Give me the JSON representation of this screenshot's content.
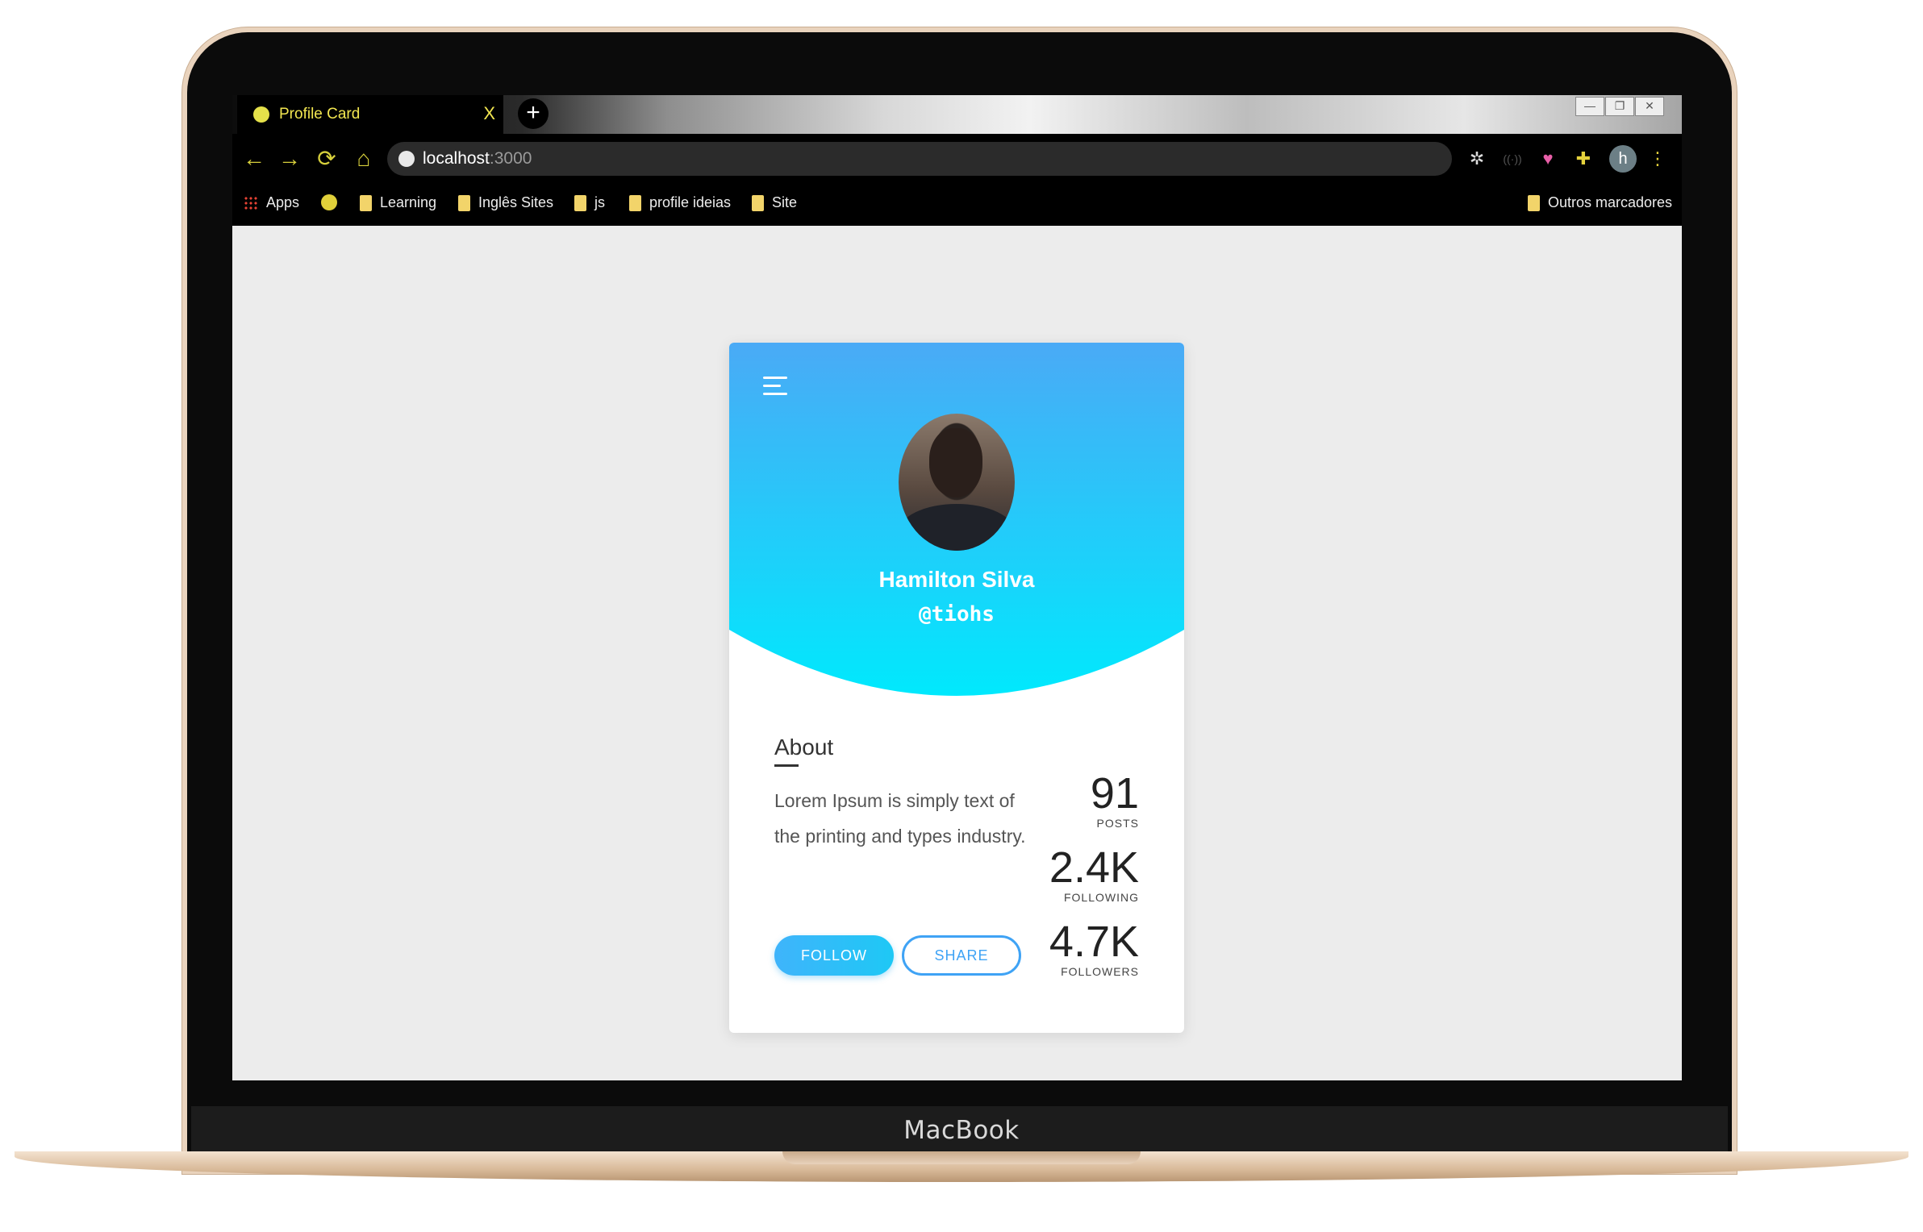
{
  "device": {
    "brand": "MacBook"
  },
  "browser": {
    "tab": {
      "title": "Profile Card",
      "close_label": "X",
      "new_tab_label": "+"
    },
    "window_controls": [
      "—",
      "❐",
      "✕"
    ],
    "nav": {
      "back": "←",
      "forward": "→",
      "reload": "⟳",
      "home": "⌂"
    },
    "address": {
      "host": "localhost",
      "port": ":3000"
    },
    "profile_initial": "h",
    "menu": "⋮",
    "bookmarks": {
      "apps": "Apps",
      "items": [
        "Learning",
        "Inglês Sites",
        "js",
        "profile ideias",
        "Site"
      ],
      "other": "Outros marcadores"
    }
  },
  "colors": {
    "header_gradient_top": "#4aaaf6",
    "header_gradient_bottom": "#00e9fd",
    "accent": "#3fa3f5",
    "page_background": "#ececec"
  },
  "profile": {
    "name": "Hamilton Silva",
    "handle": "@tiohs",
    "about_title": "About",
    "about_text": "Lorem Ipsum is simply text of the printing and types industry.",
    "stats": [
      {
        "value": "91",
        "label": "POSTS"
      },
      {
        "value": "2.4K",
        "label": "FOLLOWING"
      },
      {
        "value": "4.7K",
        "label": "FOLLOWERS"
      }
    ],
    "follow_label": "FOLLOW",
    "share_label": "SHARE"
  }
}
